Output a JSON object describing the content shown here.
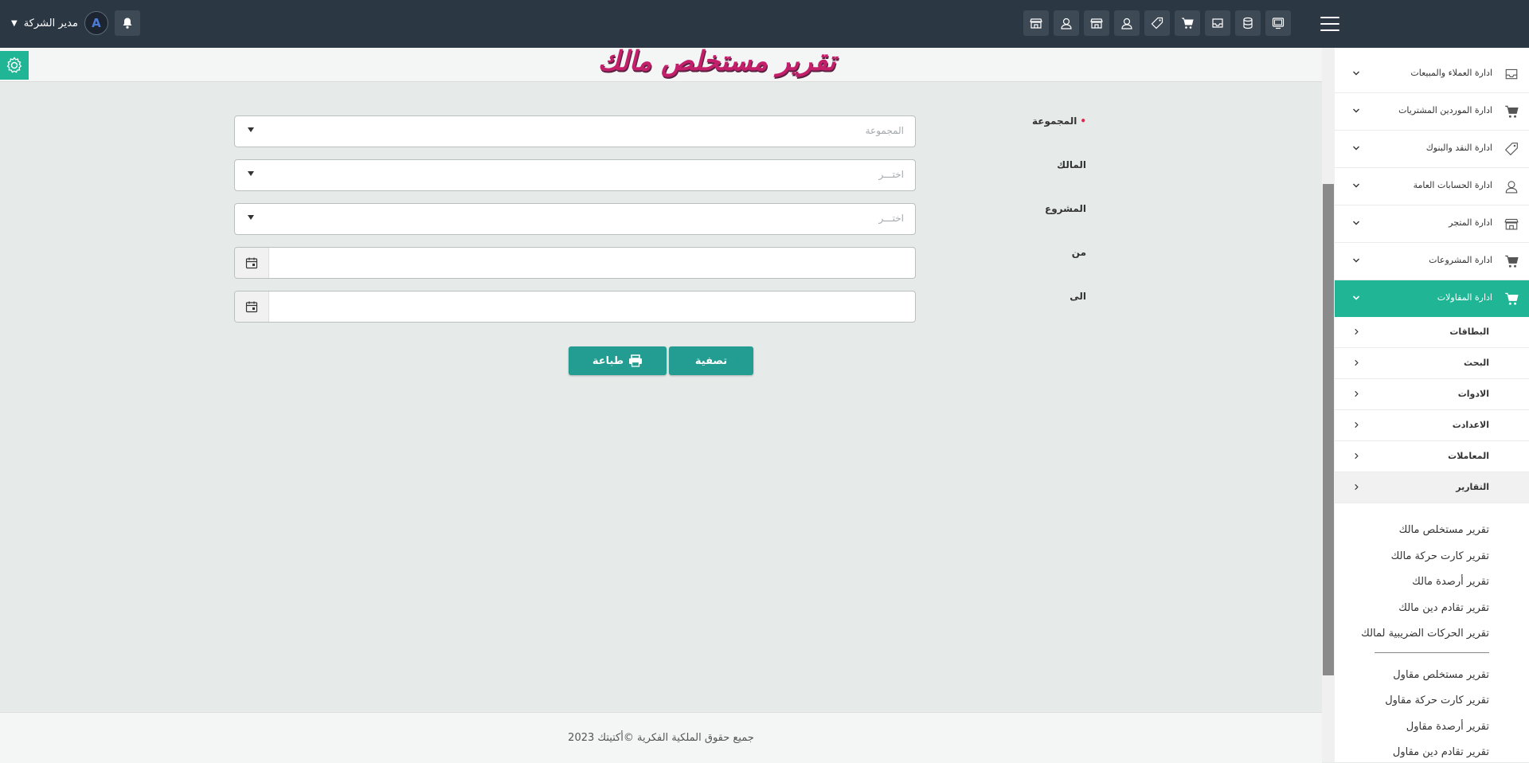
{
  "header": {
    "user_name": "مدير الشركة",
    "toolbar_icons": [
      "screen-icon",
      "database-icon",
      "inbox-icon",
      "cart-icon",
      "tag-icon",
      "user-icon",
      "store-icon",
      "user-icon",
      "store-icon"
    ]
  },
  "page": {
    "title": "تقرير مستخلص مالك",
    "form": {
      "group_label": "المجموعة",
      "group_placeholder": "المجموعة",
      "owner_label": "المالك",
      "owner_placeholder": "اختـــر",
      "project_label": "المشروع",
      "project_placeholder": "اختـــر",
      "from_label": "من",
      "to_label": "الى"
    },
    "actions": {
      "filter_label": "تصفية",
      "print_label": "طباعة"
    },
    "footer": "جميع حقوق الملكية الفكرية ©أكتيتك 2023"
  },
  "sidebar": {
    "modules": [
      {
        "label": "ادارة العملاء والمبيعات",
        "icon": "inbox-icon"
      },
      {
        "label": "ادارة الموردين المشتريات",
        "icon": "cart-icon"
      },
      {
        "label": "ادارة النقد والبنوك",
        "icon": "tag-icon"
      },
      {
        "label": "ادارة الحسابات العامة",
        "icon": "user-icon"
      },
      {
        "label": "ادارة المتجر",
        "icon": "store-icon"
      },
      {
        "label": "ادارة المشروعات",
        "icon": "cart-icon"
      },
      {
        "label": "ادارة المقاولات",
        "icon": "cart-icon",
        "active": true
      }
    ],
    "subsections": [
      {
        "label": "البطاقات"
      },
      {
        "label": "البحث"
      },
      {
        "label": "الادوات"
      },
      {
        "label": "الاعدادت"
      },
      {
        "label": "المعاملات"
      },
      {
        "label": "التقارير"
      }
    ],
    "owner_reports": [
      "تقرير مستخلص مالك",
      "تقرير كارت حركة مالك",
      "تقرير أرصدة مالك",
      "تقرير تقادم دين مالك",
      "تقرير الحركات الضريبية لمالك"
    ],
    "contractor_reports": [
      "تقرير مستخلص مقاول",
      "تقرير كارت حركة مقاول",
      "تقرير أرصدة مقاول",
      "تقرير تقادم دين مقاول"
    ]
  },
  "colors": {
    "topbar": "#2b3844",
    "accent": "#1fb595",
    "button": "#239d91",
    "title": "#c41f6a"
  }
}
